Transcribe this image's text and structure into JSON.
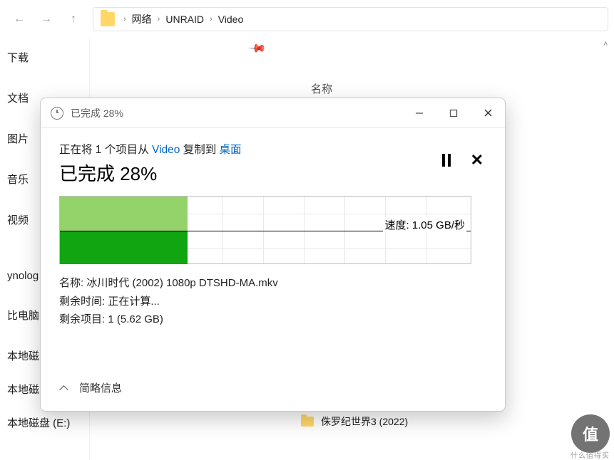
{
  "nav": {
    "back": "←",
    "fwd": "→",
    "up": "↑"
  },
  "breadcrumb": {
    "items": [
      "网络",
      "UNRAID",
      "Video"
    ]
  },
  "sidebar": {
    "items": [
      "下载",
      "文档",
      "图片",
      "音乐",
      "视频",
      "",
      "ynolog",
      "",
      "比电脑",
      "",
      "本地磁",
      "本地磁",
      "本地磁盘 (E:)"
    ]
  },
  "header": {
    "name_col": "名称"
  },
  "listing": {
    "rows": [
      "侏罗纪世界3 (2022)"
    ]
  },
  "dialog": {
    "title": "已完成 28%",
    "copy_prefix": "正在将 1 个项目从 ",
    "copy_from": "Video",
    "copy_mid": " 复制到 ",
    "copy_to": "桌面",
    "big": "已完成 28%",
    "speed_label": "速度: 1.05 GB/秒",
    "name_label": "名称: ",
    "name_value": "冰川时代 (2002) 1080p DTSHD-MA.mkv",
    "time_label": "剩余时间: ",
    "time_value": "正在计算...",
    "items_label": "剩余项目: ",
    "items_value": "1 (5.62 GB)",
    "toggle": "简略信息",
    "progress_pct": 31
  },
  "chart_data": {
    "type": "area",
    "title": "",
    "xlabel": "",
    "ylabel": "",
    "ylim": [
      0,
      2.0
    ],
    "series": [
      {
        "name": "speed_GBps",
        "values": [
          1.05
        ]
      }
    ],
    "progress_pct": 28,
    "speed_label": "速度: 1.05 GB/秒"
  },
  "watermark": {
    "char": "值",
    "brand": "什么值得买"
  }
}
